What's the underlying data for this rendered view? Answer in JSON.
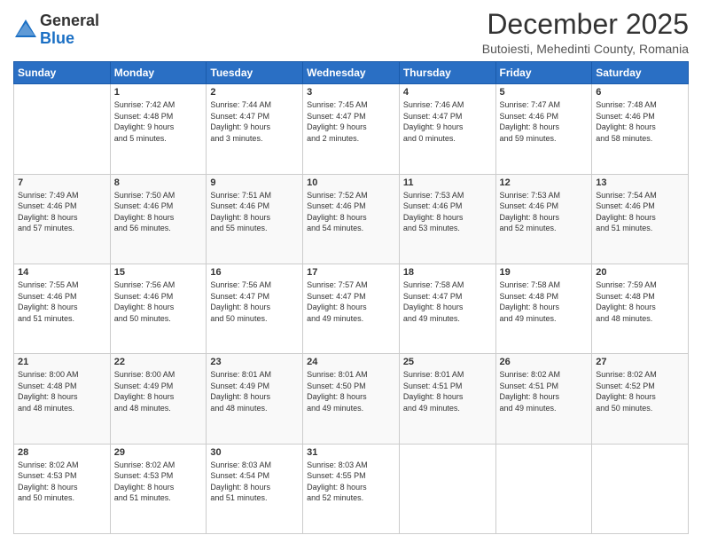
{
  "header": {
    "logo_general": "General",
    "logo_blue": "Blue",
    "main_title": "December 2025",
    "subtitle": "Butoiesti, Mehedinti County, Romania"
  },
  "calendar": {
    "days_of_week": [
      "Sunday",
      "Monday",
      "Tuesday",
      "Wednesday",
      "Thursday",
      "Friday",
      "Saturday"
    ],
    "weeks": [
      [
        {
          "day": "",
          "info": ""
        },
        {
          "day": "1",
          "info": "Sunrise: 7:42 AM\nSunset: 4:48 PM\nDaylight: 9 hours\nand 5 minutes."
        },
        {
          "day": "2",
          "info": "Sunrise: 7:44 AM\nSunset: 4:47 PM\nDaylight: 9 hours\nand 3 minutes."
        },
        {
          "day": "3",
          "info": "Sunrise: 7:45 AM\nSunset: 4:47 PM\nDaylight: 9 hours\nand 2 minutes."
        },
        {
          "day": "4",
          "info": "Sunrise: 7:46 AM\nSunset: 4:47 PM\nDaylight: 9 hours\nand 0 minutes."
        },
        {
          "day": "5",
          "info": "Sunrise: 7:47 AM\nSunset: 4:46 PM\nDaylight: 8 hours\nand 59 minutes."
        },
        {
          "day": "6",
          "info": "Sunrise: 7:48 AM\nSunset: 4:46 PM\nDaylight: 8 hours\nand 58 minutes."
        }
      ],
      [
        {
          "day": "7",
          "info": "Sunrise: 7:49 AM\nSunset: 4:46 PM\nDaylight: 8 hours\nand 57 minutes."
        },
        {
          "day": "8",
          "info": "Sunrise: 7:50 AM\nSunset: 4:46 PM\nDaylight: 8 hours\nand 56 minutes."
        },
        {
          "day": "9",
          "info": "Sunrise: 7:51 AM\nSunset: 4:46 PM\nDaylight: 8 hours\nand 55 minutes."
        },
        {
          "day": "10",
          "info": "Sunrise: 7:52 AM\nSunset: 4:46 PM\nDaylight: 8 hours\nand 54 minutes."
        },
        {
          "day": "11",
          "info": "Sunrise: 7:53 AM\nSunset: 4:46 PM\nDaylight: 8 hours\nand 53 minutes."
        },
        {
          "day": "12",
          "info": "Sunrise: 7:53 AM\nSunset: 4:46 PM\nDaylight: 8 hours\nand 52 minutes."
        },
        {
          "day": "13",
          "info": "Sunrise: 7:54 AM\nSunset: 4:46 PM\nDaylight: 8 hours\nand 51 minutes."
        }
      ],
      [
        {
          "day": "14",
          "info": "Sunrise: 7:55 AM\nSunset: 4:46 PM\nDaylight: 8 hours\nand 51 minutes."
        },
        {
          "day": "15",
          "info": "Sunrise: 7:56 AM\nSunset: 4:46 PM\nDaylight: 8 hours\nand 50 minutes."
        },
        {
          "day": "16",
          "info": "Sunrise: 7:56 AM\nSunset: 4:47 PM\nDaylight: 8 hours\nand 50 minutes."
        },
        {
          "day": "17",
          "info": "Sunrise: 7:57 AM\nSunset: 4:47 PM\nDaylight: 8 hours\nand 49 minutes."
        },
        {
          "day": "18",
          "info": "Sunrise: 7:58 AM\nSunset: 4:47 PM\nDaylight: 8 hours\nand 49 minutes."
        },
        {
          "day": "19",
          "info": "Sunrise: 7:58 AM\nSunset: 4:48 PM\nDaylight: 8 hours\nand 49 minutes."
        },
        {
          "day": "20",
          "info": "Sunrise: 7:59 AM\nSunset: 4:48 PM\nDaylight: 8 hours\nand 48 minutes."
        }
      ],
      [
        {
          "day": "21",
          "info": "Sunrise: 8:00 AM\nSunset: 4:48 PM\nDaylight: 8 hours\nand 48 minutes."
        },
        {
          "day": "22",
          "info": "Sunrise: 8:00 AM\nSunset: 4:49 PM\nDaylight: 8 hours\nand 48 minutes."
        },
        {
          "day": "23",
          "info": "Sunrise: 8:01 AM\nSunset: 4:49 PM\nDaylight: 8 hours\nand 48 minutes."
        },
        {
          "day": "24",
          "info": "Sunrise: 8:01 AM\nSunset: 4:50 PM\nDaylight: 8 hours\nand 49 minutes."
        },
        {
          "day": "25",
          "info": "Sunrise: 8:01 AM\nSunset: 4:51 PM\nDaylight: 8 hours\nand 49 minutes."
        },
        {
          "day": "26",
          "info": "Sunrise: 8:02 AM\nSunset: 4:51 PM\nDaylight: 8 hours\nand 49 minutes."
        },
        {
          "day": "27",
          "info": "Sunrise: 8:02 AM\nSunset: 4:52 PM\nDaylight: 8 hours\nand 50 minutes."
        }
      ],
      [
        {
          "day": "28",
          "info": "Sunrise: 8:02 AM\nSunset: 4:53 PM\nDaylight: 8 hours\nand 50 minutes."
        },
        {
          "day": "29",
          "info": "Sunrise: 8:02 AM\nSunset: 4:53 PM\nDaylight: 8 hours\nand 51 minutes."
        },
        {
          "day": "30",
          "info": "Sunrise: 8:03 AM\nSunset: 4:54 PM\nDaylight: 8 hours\nand 51 minutes."
        },
        {
          "day": "31",
          "info": "Sunrise: 8:03 AM\nSunset: 4:55 PM\nDaylight: 8 hours\nand 52 minutes."
        },
        {
          "day": "",
          "info": ""
        },
        {
          "day": "",
          "info": ""
        },
        {
          "day": "",
          "info": ""
        }
      ]
    ]
  }
}
